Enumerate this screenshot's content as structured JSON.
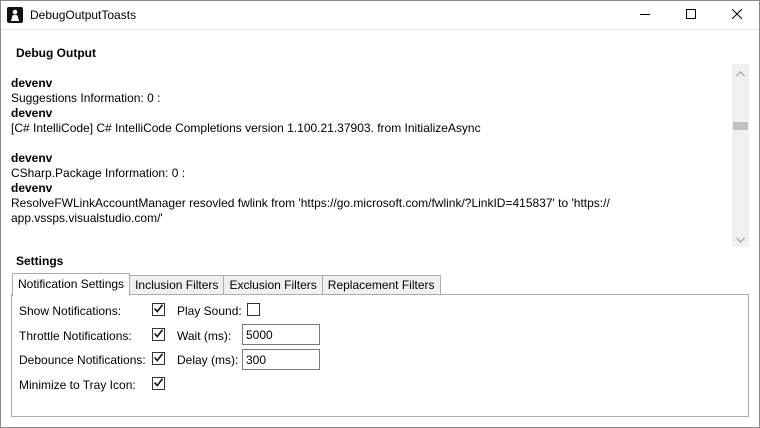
{
  "window": {
    "title": "DebugOutputToasts",
    "icon": "app-icon",
    "controls": [
      "minimize-icon",
      "maximize-icon",
      "close-icon"
    ]
  },
  "debug_output": {
    "heading": "Debug Output",
    "lines": [
      {
        "text": "devenv",
        "bold": true
      },
      {
        "text": "Suggestions Information: 0 :",
        "bold": false
      },
      {
        "text": "devenv",
        "bold": true
      },
      {
        "text": "[C# IntelliCode] C# IntelliCode Completions version 1.100.21.37903. from InitializeAsync",
        "bold": false
      },
      {
        "text": "",
        "bold": false
      },
      {
        "text": "devenv",
        "bold": true
      },
      {
        "text": "CSharp.Package Information: 0 :",
        "bold": false
      },
      {
        "text": "devenv",
        "bold": true
      },
      {
        "text": "ResolveFWLinkAccountManager resovled fwlink from 'https://go.microsoft.com/fwlink/?LinkID=415837' to 'https://",
        "bold": false
      },
      {
        "text": "app.vssps.visualstudio.com/'",
        "bold": false
      }
    ]
  },
  "settings": {
    "heading": "Settings",
    "tabs": [
      {
        "label": "Notification Settings",
        "active": true
      },
      {
        "label": "Inclusion Filters",
        "active": false
      },
      {
        "label": "Exclusion Filters",
        "active": false
      },
      {
        "label": "Replacement Filters",
        "active": false
      }
    ],
    "show_notifications": {
      "label": "Show Notifications:",
      "checked": true
    },
    "play_sound": {
      "label": "Play Sound:",
      "checked": false
    },
    "throttle_notifications": {
      "label": "Throttle Notifications:",
      "checked": true
    },
    "wait": {
      "label": "Wait (ms):",
      "value": "5000"
    },
    "debounce_notifications": {
      "label": "Debounce Notifications:",
      "checked": true
    },
    "delay": {
      "label": "Delay (ms):",
      "value": "300"
    },
    "minimize_to_tray": {
      "label": "Minimize to Tray Icon:",
      "checked": true
    }
  }
}
